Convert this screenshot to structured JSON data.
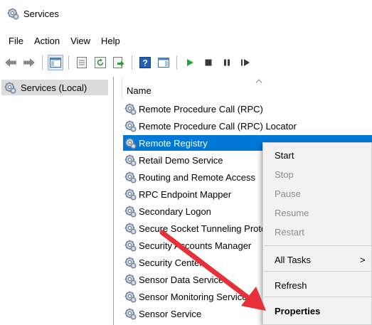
{
  "window": {
    "title": "Services"
  },
  "menubar": {
    "items": [
      "File",
      "Action",
      "View",
      "Help"
    ]
  },
  "toolbar": {
    "buttons": [
      "back-icon",
      "forward-icon",
      "show-hide-tree-icon",
      "properties-icon",
      "refresh-icon",
      "export-list-icon",
      "help-icon",
      "show-hide-action-pane-icon",
      "start-service-icon",
      "stop-service-icon",
      "pause-service-icon",
      "restart-service-icon"
    ]
  },
  "tree": {
    "root_label": "Services (Local)"
  },
  "list": {
    "column_header": "Name",
    "rows": [
      "Remote Procedure Call (RPC)",
      "Remote Procedure Call (RPC) Locator",
      "Remote Registry",
      "Retail Demo Service",
      "Routing and Remote Access",
      "RPC Endpoint Mapper",
      "Secondary Logon",
      "Secure Socket Tunneling Protocol Service",
      "Security Accounts Manager",
      "Security Center",
      "Sensor Data Service",
      "Sensor Monitoring Service",
      "Sensor Service"
    ],
    "selected_row": "Remote Registry"
  },
  "context_menu": {
    "start": "Start",
    "stop": "Stop",
    "pause": "Pause",
    "resume": "Resume",
    "restart": "Restart",
    "all_tasks": "All Tasks",
    "all_tasks_chevron": ">",
    "refresh": "Refresh",
    "properties": "Properties"
  },
  "colors": {
    "selection": "#0078d7",
    "arrow": "#e8303a",
    "menu_bg": "#f2f2f2"
  }
}
